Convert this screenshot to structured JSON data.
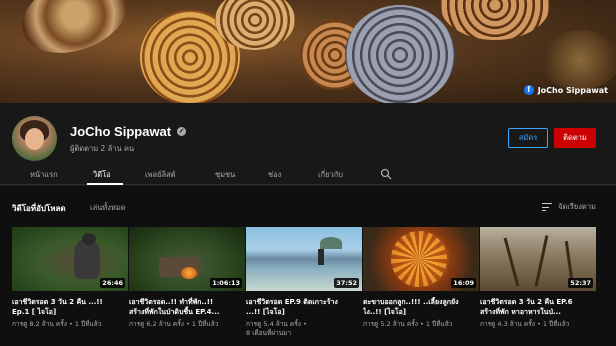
{
  "banner": {
    "social_label": "JoCho Sippawat"
  },
  "channel": {
    "name": "JoCho Sippawat",
    "subscribers": "ผู้ติดตาม 2 ล้าน คน",
    "join_label": "สมัคร",
    "subscribe_label": "ติดตาม"
  },
  "tabs": [
    {
      "label": "หน้าแรก"
    },
    {
      "label": "วิดีโอ"
    },
    {
      "label": "เพลย์ลิสต์"
    },
    {
      "label": "ชุมชน"
    },
    {
      "label": "ช่อง"
    },
    {
      "label": "เกี่ยวกับ"
    }
  ],
  "section": {
    "title": "วิดีโอที่อัปโหลด",
    "play_all": "เล่นทั้งหมด",
    "sort_label": "จัดเรียงตาม"
  },
  "videos": [
    {
      "duration": "26:46",
      "title_1": "เอาชีวิตรอด 3 วัน 2 คืน ...!!",
      "title_2": "Ep.1 [ ไจโอ]",
      "meta_1": "การดู 8.2 ล้าน ครั้ง • 1 ปีที่แล้ว",
      "meta_2": ""
    },
    {
      "duration": "1:06:13",
      "title_1": "เอาชีวิตรอด..!! ทำที่พัก..!!",
      "title_2": "สร้างที่พักในป่าดิบชื้น EP.4...",
      "meta_1": "การดู 6.2 ล้าน ครั้ง • 1 ปีที่แล้ว",
      "meta_2": ""
    },
    {
      "duration": "37:52",
      "title_1": "เอาชีวิตรอด EP.9 ติดเกาะร้าง",
      "title_2": "...!! [ไจโอ]",
      "meta_1": "การดู 5.4 ล้าน ครั้ง •",
      "meta_2": "8 เดือนที่ผ่านมา"
    },
    {
      "duration": "16:09",
      "title_1": "ตะขาบออกลูก..!!! ..เลี้ยงลูกยัง",
      "title_2": "ไง..!! [ไจโอ]",
      "meta_1": "การดู 5.2 ล้าน ครั้ง • 1 ปีที่แล้ว",
      "meta_2": ""
    },
    {
      "duration": "52:37",
      "title_1": "เอาชีวิตรอด 3 วัน 2 คืน EP.6",
      "title_2": "สร้างที่พัก หาอาหารในป่...",
      "meta_1": "การดู 4.3 ล้าน ครั้ง • 1 ปีที่แล้ว",
      "meta_2": ""
    }
  ]
}
